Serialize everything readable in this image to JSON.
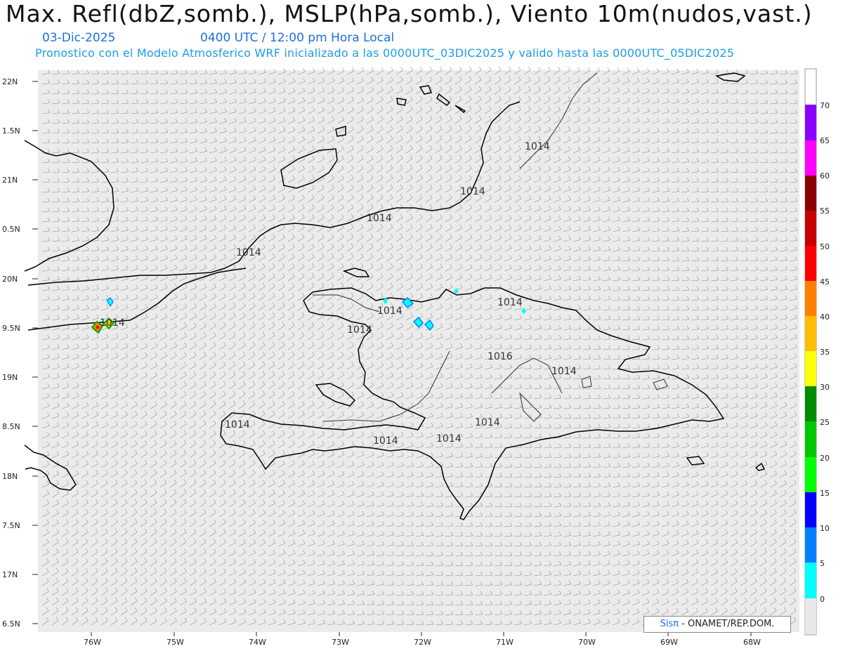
{
  "title": "Max. Refl(dbZ,somb.), MSLP(hPa,somb.), Viento 10m(nudos,vast.)",
  "date": "03-Dic-2025",
  "time": "0400 UTC / 12:00 pm Hora Local",
  "forecast_line": "Pronostico con el Modelo Atmosferico WRF inicializado a las 0000UTC_03DIC2025 y valido hasta las  0000UTC_05DIC2025",
  "credit": {
    "brand": "Sisπ",
    "rest": " - ONAMET/REP.DOM."
  },
  "lat_labels": [
    "22N",
    "1.5N",
    "21N",
    "0.5N",
    "20N",
    "9.5N",
    "19N",
    "8.5N",
    "18N",
    "7.5N",
    "17N",
    "6.5N"
  ],
  "lon_labels": [
    "76W",
    "75W",
    "74W",
    "73W",
    "72W",
    "71W",
    "70W",
    "69W",
    "68W"
  ],
  "isobar_labels": [
    "1014",
    "1014",
    "1014",
    "1014",
    "1014",
    "1014",
    "1014",
    "1014",
    "1014",
    "1016",
    "1014",
    "1014",
    "1014",
    "1014",
    "1014"
  ],
  "colorbar": {
    "labels": [
      "70",
      "65",
      "60",
      "55",
      "50",
      "45",
      "40",
      "35",
      "30",
      "25",
      "20",
      "15",
      "10",
      "5",
      "0"
    ],
    "colors": [
      "#8a00ff",
      "#ff00ff",
      "#8b0000",
      "#c80000",
      "#ff0000",
      "#ff7f00",
      "#ffbf00",
      "#ffff00",
      "#008b00",
      "#00c800",
      "#00ff00",
      "#0000ff",
      "#0080ff",
      "#00ffff",
      "#e8e8e8"
    ]
  },
  "colors": {
    "ocean": "#ebebeb",
    "coast": "#000000",
    "isobar": "#333333",
    "barb": "#707070",
    "subtitle": "#1e9be8"
  }
}
